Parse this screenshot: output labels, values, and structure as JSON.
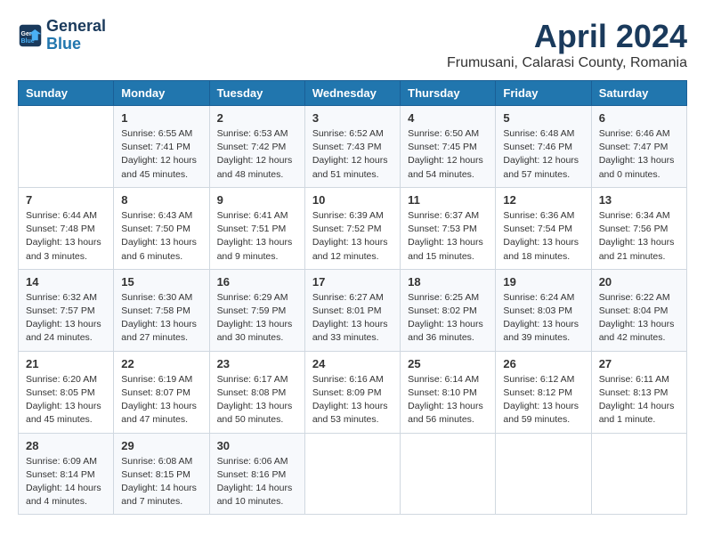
{
  "header": {
    "logo_line1": "General",
    "logo_line2": "Blue",
    "month": "April 2024",
    "location": "Frumusani, Calarasi County, Romania"
  },
  "weekdays": [
    "Sunday",
    "Monday",
    "Tuesday",
    "Wednesday",
    "Thursday",
    "Friday",
    "Saturday"
  ],
  "weeks": [
    [
      {
        "day": "",
        "info": ""
      },
      {
        "day": "1",
        "info": "Sunrise: 6:55 AM\nSunset: 7:41 PM\nDaylight: 12 hours\nand 45 minutes."
      },
      {
        "day": "2",
        "info": "Sunrise: 6:53 AM\nSunset: 7:42 PM\nDaylight: 12 hours\nand 48 minutes."
      },
      {
        "day": "3",
        "info": "Sunrise: 6:52 AM\nSunset: 7:43 PM\nDaylight: 12 hours\nand 51 minutes."
      },
      {
        "day": "4",
        "info": "Sunrise: 6:50 AM\nSunset: 7:45 PM\nDaylight: 12 hours\nand 54 minutes."
      },
      {
        "day": "5",
        "info": "Sunrise: 6:48 AM\nSunset: 7:46 PM\nDaylight: 12 hours\nand 57 minutes."
      },
      {
        "day": "6",
        "info": "Sunrise: 6:46 AM\nSunset: 7:47 PM\nDaylight: 13 hours\nand 0 minutes."
      }
    ],
    [
      {
        "day": "7",
        "info": "Sunrise: 6:44 AM\nSunset: 7:48 PM\nDaylight: 13 hours\nand 3 minutes."
      },
      {
        "day": "8",
        "info": "Sunrise: 6:43 AM\nSunset: 7:50 PM\nDaylight: 13 hours\nand 6 minutes."
      },
      {
        "day": "9",
        "info": "Sunrise: 6:41 AM\nSunset: 7:51 PM\nDaylight: 13 hours\nand 9 minutes."
      },
      {
        "day": "10",
        "info": "Sunrise: 6:39 AM\nSunset: 7:52 PM\nDaylight: 13 hours\nand 12 minutes."
      },
      {
        "day": "11",
        "info": "Sunrise: 6:37 AM\nSunset: 7:53 PM\nDaylight: 13 hours\nand 15 minutes."
      },
      {
        "day": "12",
        "info": "Sunrise: 6:36 AM\nSunset: 7:54 PM\nDaylight: 13 hours\nand 18 minutes."
      },
      {
        "day": "13",
        "info": "Sunrise: 6:34 AM\nSunset: 7:56 PM\nDaylight: 13 hours\nand 21 minutes."
      }
    ],
    [
      {
        "day": "14",
        "info": "Sunrise: 6:32 AM\nSunset: 7:57 PM\nDaylight: 13 hours\nand 24 minutes."
      },
      {
        "day": "15",
        "info": "Sunrise: 6:30 AM\nSunset: 7:58 PM\nDaylight: 13 hours\nand 27 minutes."
      },
      {
        "day": "16",
        "info": "Sunrise: 6:29 AM\nSunset: 7:59 PM\nDaylight: 13 hours\nand 30 minutes."
      },
      {
        "day": "17",
        "info": "Sunrise: 6:27 AM\nSunset: 8:01 PM\nDaylight: 13 hours\nand 33 minutes."
      },
      {
        "day": "18",
        "info": "Sunrise: 6:25 AM\nSunset: 8:02 PM\nDaylight: 13 hours\nand 36 minutes."
      },
      {
        "day": "19",
        "info": "Sunrise: 6:24 AM\nSunset: 8:03 PM\nDaylight: 13 hours\nand 39 minutes."
      },
      {
        "day": "20",
        "info": "Sunrise: 6:22 AM\nSunset: 8:04 PM\nDaylight: 13 hours\nand 42 minutes."
      }
    ],
    [
      {
        "day": "21",
        "info": "Sunrise: 6:20 AM\nSunset: 8:05 PM\nDaylight: 13 hours\nand 45 minutes."
      },
      {
        "day": "22",
        "info": "Sunrise: 6:19 AM\nSunset: 8:07 PM\nDaylight: 13 hours\nand 47 minutes."
      },
      {
        "day": "23",
        "info": "Sunrise: 6:17 AM\nSunset: 8:08 PM\nDaylight: 13 hours\nand 50 minutes."
      },
      {
        "day": "24",
        "info": "Sunrise: 6:16 AM\nSunset: 8:09 PM\nDaylight: 13 hours\nand 53 minutes."
      },
      {
        "day": "25",
        "info": "Sunrise: 6:14 AM\nSunset: 8:10 PM\nDaylight: 13 hours\nand 56 minutes."
      },
      {
        "day": "26",
        "info": "Sunrise: 6:12 AM\nSunset: 8:12 PM\nDaylight: 13 hours\nand 59 minutes."
      },
      {
        "day": "27",
        "info": "Sunrise: 6:11 AM\nSunset: 8:13 PM\nDaylight: 14 hours\nand 1 minute."
      }
    ],
    [
      {
        "day": "28",
        "info": "Sunrise: 6:09 AM\nSunset: 8:14 PM\nDaylight: 14 hours\nand 4 minutes."
      },
      {
        "day": "29",
        "info": "Sunrise: 6:08 AM\nSunset: 8:15 PM\nDaylight: 14 hours\nand 7 minutes."
      },
      {
        "day": "30",
        "info": "Sunrise: 6:06 AM\nSunset: 8:16 PM\nDaylight: 14 hours\nand 10 minutes."
      },
      {
        "day": "",
        "info": ""
      },
      {
        "day": "",
        "info": ""
      },
      {
        "day": "",
        "info": ""
      },
      {
        "day": "",
        "info": ""
      }
    ]
  ]
}
